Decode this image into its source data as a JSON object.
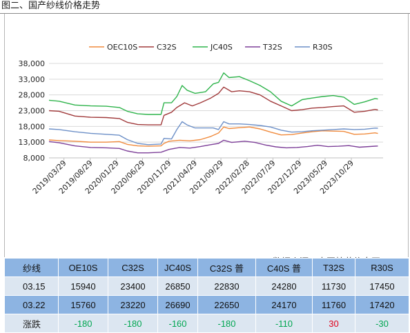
{
  "header": {
    "title": "图二、国产纱线价格走势"
  },
  "source": "数据来源：中国棉花信息网",
  "colors": {
    "OEC10S": "#f08a3c",
    "C32S": "#a0393a",
    "JC40S": "#2db34a",
    "T32S": "#7d3f98",
    "R30S": "#6c8fc7",
    "grid": "#d9d9d9",
    "axis": "#bfbfbf",
    "table_dark": "#8db4e2",
    "table_light": "#dce6f1",
    "down": "#00a651",
    "up": "#e0001b"
  },
  "chart_data": {
    "type": "line",
    "title": "",
    "xlabel": "",
    "ylabel": "",
    "ylim": [
      8000,
      38000
    ],
    "yticks": [
      8000,
      13000,
      18000,
      23000,
      28000,
      33000,
      38000
    ],
    "ytick_labels": [
      "8,000",
      "13,000",
      "18,000",
      "23,000",
      "28,000",
      "33,000",
      "38,000"
    ],
    "xlim": [
      "2019-01-01",
      "2024-05-01"
    ],
    "xticks": [
      "2019-03-29",
      "2019-08-29",
      "2020-01-29",
      "2020-06-29",
      "2020-11-29",
      "2021-04-29",
      "2021-09-29",
      "2022-02-28",
      "2022-07-29",
      "2022-12-29",
      "2023-05-29",
      "2023-10-29"
    ],
    "xtick_labels": [
      "2019/03/29",
      "2019/08/29",
      "2020/01/29",
      "2020/06/29",
      "2020/11/29",
      "2021/04/29",
      "2021/09/29",
      "2022/02/28",
      "2022/07/29",
      "2022/12/29",
      "2023/05/29",
      "2023/10/29"
    ],
    "grid": "horizontal",
    "legend_position": "top",
    "series": [
      {
        "name": "OEC10S",
        "points": [
          [
            "2019-01-01",
            13700
          ],
          [
            "2019-03-01",
            13500
          ],
          [
            "2019-06-01",
            13300
          ],
          [
            "2019-09-01",
            13000
          ],
          [
            "2019-12-01",
            13000
          ],
          [
            "2020-02-15",
            13200
          ],
          [
            "2020-04-01",
            12300
          ],
          [
            "2020-06-01",
            11800
          ],
          [
            "2020-08-01",
            11700
          ],
          [
            "2020-10-15",
            11800
          ],
          [
            "2020-11-01",
            12600
          ],
          [
            "2020-12-01",
            13300
          ],
          [
            "2021-02-01",
            13600
          ],
          [
            "2021-04-01",
            13400
          ],
          [
            "2021-06-01",
            13800
          ],
          [
            "2021-08-01",
            14800
          ],
          [
            "2021-09-15",
            15900
          ],
          [
            "2021-10-15",
            17800
          ],
          [
            "2021-11-15",
            17300
          ],
          [
            "2022-01-15",
            17600
          ],
          [
            "2022-03-15",
            17800
          ],
          [
            "2022-05-15",
            17200
          ],
          [
            "2022-07-15",
            16200
          ],
          [
            "2022-09-15",
            15300
          ],
          [
            "2022-11-15",
            15400
          ],
          [
            "2023-01-15",
            15900
          ],
          [
            "2023-03-15",
            16300
          ],
          [
            "2023-05-15",
            16600
          ],
          [
            "2023-07-15",
            16500
          ],
          [
            "2023-09-15",
            16400
          ],
          [
            "2023-11-15",
            15500
          ],
          [
            "2024-01-15",
            15600
          ],
          [
            "2024-03-15",
            15940
          ],
          [
            "2024-04-01",
            15760
          ]
        ]
      },
      {
        "name": "C32S",
        "points": [
          [
            "2019-01-01",
            23000
          ],
          [
            "2019-03-01",
            22800
          ],
          [
            "2019-06-01",
            21300
          ],
          [
            "2019-09-01",
            20900
          ],
          [
            "2019-12-01",
            20800
          ],
          [
            "2020-02-15",
            20500
          ],
          [
            "2020-04-01",
            19300
          ],
          [
            "2020-06-01",
            18600
          ],
          [
            "2020-08-01",
            18500
          ],
          [
            "2020-10-15",
            18500
          ],
          [
            "2020-11-01",
            21500
          ],
          [
            "2020-12-15",
            22500
          ],
          [
            "2021-01-15",
            24000
          ],
          [
            "2021-03-01",
            25500
          ],
          [
            "2021-04-15",
            24500
          ],
          [
            "2021-06-01",
            25500
          ],
          [
            "2021-08-01",
            27000
          ],
          [
            "2021-09-15",
            28500
          ],
          [
            "2021-10-15",
            30500
          ],
          [
            "2021-12-01",
            29000
          ],
          [
            "2022-01-15",
            29300
          ],
          [
            "2022-03-15",
            29000
          ],
          [
            "2022-05-15",
            28000
          ],
          [
            "2022-07-15",
            26000
          ],
          [
            "2022-09-15",
            24500
          ],
          [
            "2022-11-15",
            23000
          ],
          [
            "2023-01-15",
            23300
          ],
          [
            "2023-03-15",
            23800
          ],
          [
            "2023-05-15",
            24000
          ],
          [
            "2023-07-15",
            24300
          ],
          [
            "2023-09-15",
            24500
          ],
          [
            "2023-11-15",
            22500
          ],
          [
            "2024-01-15",
            22800
          ],
          [
            "2024-03-15",
            23400
          ],
          [
            "2024-04-01",
            23220
          ]
        ]
      },
      {
        "name": "JC40S",
        "points": [
          [
            "2019-01-01",
            26300
          ],
          [
            "2019-03-01",
            26000
          ],
          [
            "2019-06-01",
            24800
          ],
          [
            "2019-09-01",
            24500
          ],
          [
            "2019-12-01",
            24400
          ],
          [
            "2020-02-15",
            24000
          ],
          [
            "2020-04-01",
            22800
          ],
          [
            "2020-06-01",
            22000
          ],
          [
            "2020-08-01",
            21800
          ],
          [
            "2020-10-15",
            21800
          ],
          [
            "2020-11-01",
            25500
          ],
          [
            "2020-12-15",
            25500
          ],
          [
            "2021-01-15",
            27500
          ],
          [
            "2021-02-15",
            31000
          ],
          [
            "2021-03-15",
            29500
          ],
          [
            "2021-05-01",
            28500
          ],
          [
            "2021-07-01",
            29000
          ],
          [
            "2021-08-15",
            31500
          ],
          [
            "2021-09-15",
            32000
          ],
          [
            "2021-10-15",
            35000
          ],
          [
            "2021-11-15",
            33500
          ],
          [
            "2022-01-15",
            33800
          ],
          [
            "2022-03-15",
            32500
          ],
          [
            "2022-05-15",
            31000
          ],
          [
            "2022-07-15",
            29000
          ],
          [
            "2022-09-15",
            26000
          ],
          [
            "2022-11-15",
            24500
          ],
          [
            "2023-01-15",
            26500
          ],
          [
            "2023-03-15",
            27000
          ],
          [
            "2023-05-15",
            27500
          ],
          [
            "2023-07-15",
            27800
          ],
          [
            "2023-09-15",
            27300
          ],
          [
            "2023-11-15",
            25000
          ],
          [
            "2024-01-15",
            25800
          ],
          [
            "2024-03-15",
            26850
          ],
          [
            "2024-04-01",
            26690
          ]
        ]
      },
      {
        "name": "T32S",
        "points": [
          [
            "2019-01-01",
            13200
          ],
          [
            "2019-03-01",
            12800
          ],
          [
            "2019-06-01",
            11800
          ],
          [
            "2019-09-01",
            11300
          ],
          [
            "2019-12-01",
            11200
          ],
          [
            "2020-02-15",
            11000
          ],
          [
            "2020-04-01",
            10200
          ],
          [
            "2020-06-01",
            9600
          ],
          [
            "2020-08-01",
            9600
          ],
          [
            "2020-10-15",
            9800
          ],
          [
            "2020-12-01",
            10700
          ],
          [
            "2021-02-01",
            11300
          ],
          [
            "2021-04-01",
            11100
          ],
          [
            "2021-06-01",
            11600
          ],
          [
            "2021-08-01",
            12200
          ],
          [
            "2021-09-15",
            12600
          ],
          [
            "2021-10-15",
            13600
          ],
          [
            "2021-12-01",
            12900
          ],
          [
            "2022-02-15",
            13300
          ],
          [
            "2022-04-15",
            12900
          ],
          [
            "2022-06-15",
            12100
          ],
          [
            "2022-08-15",
            11500
          ],
          [
            "2022-10-15",
            11200
          ],
          [
            "2022-12-15",
            11300
          ],
          [
            "2023-02-15",
            11600
          ],
          [
            "2023-04-15",
            12000
          ],
          [
            "2023-06-15",
            11600
          ],
          [
            "2023-08-15",
            11700
          ],
          [
            "2023-10-15",
            11900
          ],
          [
            "2023-12-15",
            11400
          ],
          [
            "2024-03-15",
            11730
          ],
          [
            "2024-04-01",
            11760
          ]
        ]
      },
      {
        "name": "R30S",
        "points": [
          [
            "2019-01-01",
            17200
          ],
          [
            "2019-03-01",
            17000
          ],
          [
            "2019-06-01",
            16300
          ],
          [
            "2019-09-01",
            15800
          ],
          [
            "2019-12-01",
            15500
          ],
          [
            "2020-02-15",
            15200
          ],
          [
            "2020-04-01",
            13800
          ],
          [
            "2020-06-01",
            12600
          ],
          [
            "2020-08-01",
            12200
          ],
          [
            "2020-10-15",
            12400
          ],
          [
            "2020-11-01",
            14200
          ],
          [
            "2020-12-15",
            14000
          ],
          [
            "2021-01-15",
            17000
          ],
          [
            "2021-02-15",
            19500
          ],
          [
            "2021-03-15",
            18500
          ],
          [
            "2021-05-01",
            17500
          ],
          [
            "2021-07-01",
            17500
          ],
          [
            "2021-08-15",
            17500
          ],
          [
            "2021-09-15",
            17000
          ],
          [
            "2021-10-15",
            19500
          ],
          [
            "2021-11-15",
            18800
          ],
          [
            "2022-01-15",
            18800
          ],
          [
            "2022-03-15",
            18600
          ],
          [
            "2022-05-15",
            18300
          ],
          [
            "2022-07-15",
            17800
          ],
          [
            "2022-09-15",
            16800
          ],
          [
            "2022-11-15",
            16200
          ],
          [
            "2023-01-15",
            16300
          ],
          [
            "2023-03-15",
            16600
          ],
          [
            "2023-05-15",
            16800
          ],
          [
            "2023-07-15",
            17000
          ],
          [
            "2023-09-15",
            17200
          ],
          [
            "2023-11-15",
            17000
          ],
          [
            "2024-01-15",
            17100
          ],
          [
            "2024-03-15",
            17450
          ],
          [
            "2024-04-01",
            17420
          ]
        ]
      }
    ]
  },
  "table": {
    "headers": [
      "纱线",
      "OE10S",
      "C32S",
      "JC40S",
      "C32S 普",
      "C40S 普",
      "T32S",
      "R30S"
    ],
    "rows": [
      {
        "label": "03.15",
        "cells": [
          "15940",
          "23400",
          "26850",
          "22830",
          "24280",
          "11730",
          "17450"
        ]
      },
      {
        "label": "03.22",
        "cells": [
          "15760",
          "23220",
          "26690",
          "22650",
          "24170",
          "11760",
          "17420"
        ]
      }
    ],
    "change": {
      "label": "涨跌",
      "cells": [
        {
          "text": "-180",
          "dir": "down"
        },
        {
          "text": "-180",
          "dir": "down"
        },
        {
          "text": "-160",
          "dir": "down"
        },
        {
          "text": "-180",
          "dir": "down"
        },
        {
          "text": "-110",
          "dir": "down"
        },
        {
          "text": "30",
          "dir": "up"
        },
        {
          "text": "-30",
          "dir": "down"
        }
      ]
    }
  }
}
